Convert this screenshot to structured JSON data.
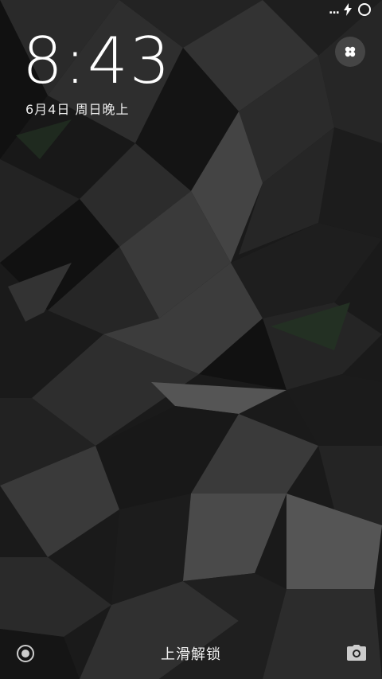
{
  "status_bar": {
    "signal_text": "...",
    "charging_icon": "bolt-icon",
    "battery_icon": "battery-ring-icon"
  },
  "lockscreen": {
    "time": "8:43",
    "date": "6月4日 周日晚上",
    "quick_toggle_icon": "four-petal-icon"
  },
  "bottom": {
    "unlock_hint": "上滑解锁",
    "left_icon": "target-icon",
    "right_icon": "camera-icon"
  },
  "colors": {
    "background": "#1b1b1b",
    "text": "#ffffff"
  }
}
